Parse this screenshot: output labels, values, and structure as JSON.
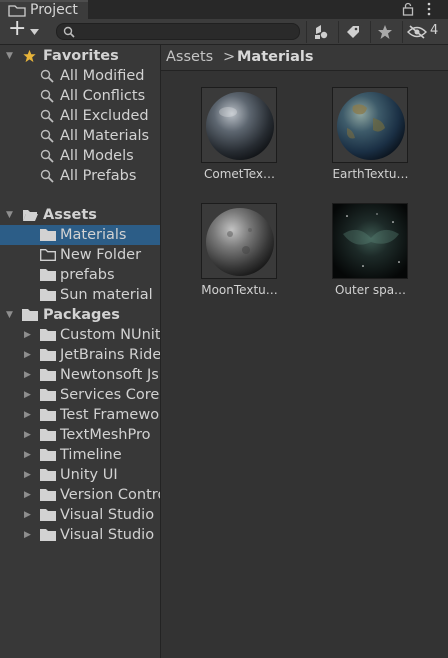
{
  "window": {
    "tab_title": "Project",
    "tab_icon": "folder-icon",
    "lock_icon": "lock-icon",
    "menu_icon": "kebab-menu-icon"
  },
  "toolbar": {
    "create_label": "+",
    "search_placeholder": "",
    "hidden_count": "4",
    "buttons": [
      "scene-filter-icon",
      "label-tag-icon",
      "favorite-star-icon",
      "hidden-eye-icon"
    ]
  },
  "tree": {
    "favorites": {
      "label": "Favorites",
      "items": [
        "All Modified",
        "All Conflicts",
        "All Excluded",
        "All Materials",
        "All Models",
        "All Prefabs"
      ]
    },
    "assets": {
      "label": "Assets",
      "items": [
        {
          "label": "Materials",
          "selected": true
        },
        {
          "label": "New Folder",
          "empty": true
        },
        {
          "label": "prefabs"
        },
        {
          "label": "Sun material"
        }
      ]
    },
    "packages": {
      "label": "Packages",
      "items": [
        "Custom NUnit",
        "JetBrains Ride",
        "Newtonsoft Js",
        "Services Core",
        "Test Framewo",
        "TextMeshPro",
        "Timeline",
        "Unity UI",
        "Version Contro",
        "Visual Studio",
        "Visual Studio"
      ]
    }
  },
  "breadcrumb": {
    "root": "Assets",
    "separator": ">",
    "current": "Materials"
  },
  "assets": [
    {
      "name": "CometTex…",
      "kind": "comet"
    },
    {
      "name": "EarthTextu…",
      "kind": "earth"
    },
    {
      "name": "MoonTextu…",
      "kind": "moon"
    },
    {
      "name": "Outer spa…",
      "kind": "space"
    }
  ],
  "colors": {
    "selection": "#2c5d87",
    "background": "#383838",
    "panel": "#333333"
  }
}
